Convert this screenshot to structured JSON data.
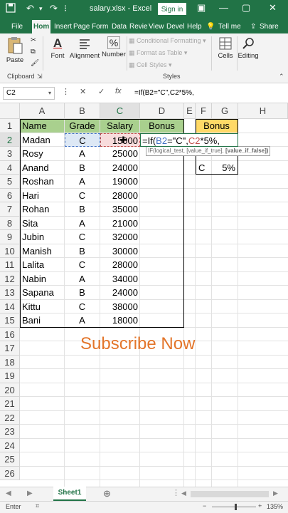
{
  "titlebar": {
    "title": "salary.xlsx - Excel",
    "signin_label": "Sign in",
    "autosave_icon": "save-icon",
    "undo_icon": "undo-icon",
    "redo_icon": "redo-icon"
  },
  "tabs": [
    "File",
    "Hom",
    "Insert",
    "Page",
    "Form",
    "Data",
    "Revie",
    "View",
    "Devel",
    "Help"
  ],
  "tell_me": "Tell me",
  "share": "Share",
  "ribbon": {
    "paste": "Paste",
    "font": "Font",
    "alignment": "Alignment",
    "number": "Number",
    "conditional": "Conditional Formatting",
    "format_table": "Format as Table",
    "cell_styles": "Cell Styles",
    "cells": "Cells",
    "editing": "Editing",
    "clipboard": "Clipboard",
    "styles": "Styles"
  },
  "formula_bar": {
    "name_box": "C2",
    "formula": "=If(B2=\"C\",C2*5%,"
  },
  "columns": [
    "A",
    "B",
    "C",
    "D",
    "E",
    "F",
    "G",
    "H"
  ],
  "rows": [
    "1",
    "2",
    "3",
    "4",
    "5",
    "6",
    "7",
    "8",
    "9",
    "10",
    "11",
    "12",
    "13",
    "14",
    "15",
    "16",
    "17",
    "18",
    "19",
    "20",
    "21",
    "22",
    "23",
    "24",
    "25",
    "26"
  ],
  "table": {
    "headers": [
      "Name",
      "Grade",
      "Salary",
      "Bonus"
    ],
    "data": [
      [
        "Madan",
        "C",
        "15000"
      ],
      [
        "Rosy",
        "A",
        "25000"
      ],
      [
        "Anand",
        "B",
        "24000"
      ],
      [
        "Roshan",
        "A",
        "19000"
      ],
      [
        "Hari",
        "C",
        "28000"
      ],
      [
        "Rohan",
        "B",
        "35000"
      ],
      [
        "Sita",
        "A",
        "21000"
      ],
      [
        "Jubin",
        "C",
        "32000"
      ],
      [
        "Manish",
        "B",
        "30000"
      ],
      [
        "Lalita",
        "C",
        "28000"
      ],
      [
        "Nabin",
        "A",
        "34000"
      ],
      [
        "Sapana",
        "B",
        "24000"
      ],
      [
        "Kittu",
        "C",
        "38000"
      ],
      [
        "Bani",
        "A",
        "18000"
      ]
    ]
  },
  "editing_formula": {
    "prefix": "=If(",
    "ref1": "B2",
    "mid": "=\"C\",",
    "ref2": "C2",
    "suffix": "*5%,"
  },
  "tooltip": {
    "text": "IF(logical_test, [value_if_true], ",
    "bold": "[value_if_false])"
  },
  "bonus_table": {
    "header": "Bonus",
    "grade": "C",
    "rate": "5%"
  },
  "subscribe": "Subscribe Now",
  "sheet_tab": "Sheet1",
  "status": {
    "mode": "Enter",
    "zoom": "135%"
  },
  "colors": {
    "excel_green": "#217346",
    "header_green": "#a9d08e",
    "header_yellow": "#ffd966",
    "subscribe_orange": "#e3752a",
    "ref_blue": "#4472c4",
    "ref_red": "#c0504d"
  }
}
